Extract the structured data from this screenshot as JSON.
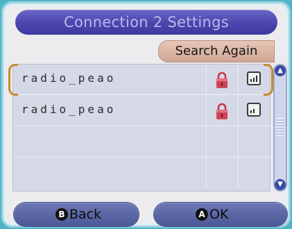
{
  "header": {
    "title": "Connection 2 Settings"
  },
  "search": {
    "label": "Search Again"
  },
  "networks": [
    {
      "ssid": "radio_peao",
      "locked": true,
      "signal": 3
    },
    {
      "ssid": "radio_peao",
      "locked": true,
      "signal": 2
    }
  ],
  "footer": {
    "back_badge": "B",
    "back_label": "Back",
    "ok_badge": "A",
    "ok_label": "OK"
  },
  "colors": {
    "accent": "#4b45ad",
    "lock": "#c4384d",
    "selection": "#c78a2a"
  },
  "icons": [
    "lock-icon",
    "signal-strength-icon",
    "scroll-up-arrow-icon",
    "scroll-down-arrow-icon"
  ]
}
